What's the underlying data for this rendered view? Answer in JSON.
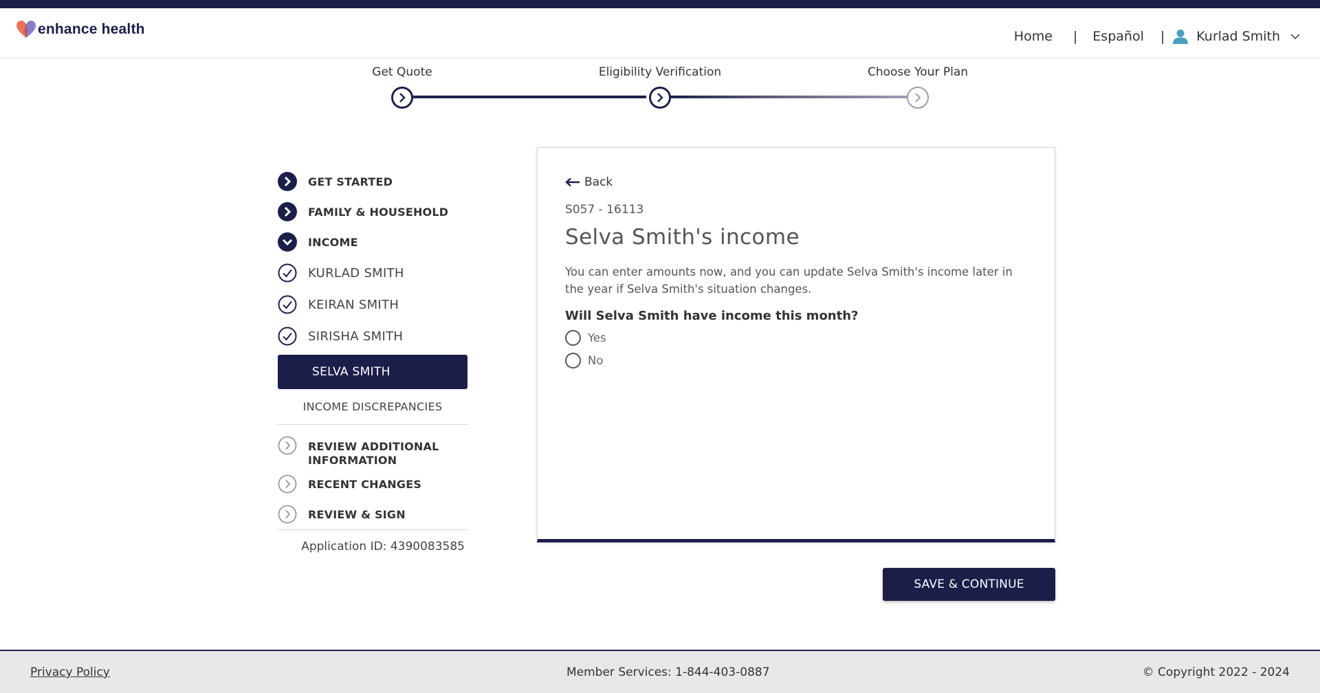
{
  "header": {
    "logo_text": "enhance health",
    "nav": {
      "home": "Home",
      "espanol": "Español",
      "separator": "|",
      "user_name": "Kurlad Smith"
    }
  },
  "progress": {
    "steps": [
      {
        "label": "Get Quote",
        "state": "done"
      },
      {
        "label": "Eligibility Verification",
        "state": "current"
      },
      {
        "label": "Choose Your Plan",
        "state": "upcoming"
      }
    ]
  },
  "sidebar": {
    "sections": [
      {
        "label": "GET STARTED",
        "icon": "chevron-right-filled-icon"
      },
      {
        "label": "FAMILY & HOUSEHOLD",
        "icon": "chevron-right-filled-icon"
      },
      {
        "label": "INCOME",
        "icon": "chevron-down-filled-icon"
      }
    ],
    "members": [
      {
        "label": "KURLAD SMITH",
        "icon": "check-circle-icon"
      },
      {
        "label": "KEIRAN SMITH",
        "icon": "check-circle-icon"
      },
      {
        "label": "SIRISHA SMITH",
        "icon": "check-circle-icon"
      }
    ],
    "selected": "SELVA SMITH",
    "discrepancies": "INCOME DISCREPANCIES",
    "later_sections": [
      {
        "label": "REVIEW ADDITIONAL INFORMATION",
        "line1": "REVIEW ADDITIONAL",
        "line2": "INFORMATION",
        "icon": "chevron-right-outline-icon"
      },
      {
        "label": "RECENT CHANGES",
        "icon": "chevron-right-outline-icon"
      },
      {
        "label": "REVIEW & SIGN",
        "icon": "chevron-right-outline-icon"
      }
    ],
    "application_id": "Application ID: 4390083585"
  },
  "card": {
    "back_label": "Back",
    "code": "S057 - 16113",
    "title": "Selva Smith's income",
    "description": "You can enter amounts now, and you can update Selva Smith's income later in the year if Selva Smith's situation changes.",
    "question": "Will Selva Smith have income this month?",
    "options": [
      "Yes",
      "No"
    ]
  },
  "actions": {
    "save_continue": "SAVE & CONTINUE"
  },
  "footer": {
    "privacy": "Privacy Policy",
    "member_services": "Member Services: 1-844-403-0887",
    "copyright": "© Copyright 2022 - 2024"
  },
  "colors": {
    "primary": "#1c1e4a",
    "logo_heart_left": "#e8735a",
    "logo_heart_right": "#8a7cc8",
    "user_icon": "#4a9fc0"
  }
}
